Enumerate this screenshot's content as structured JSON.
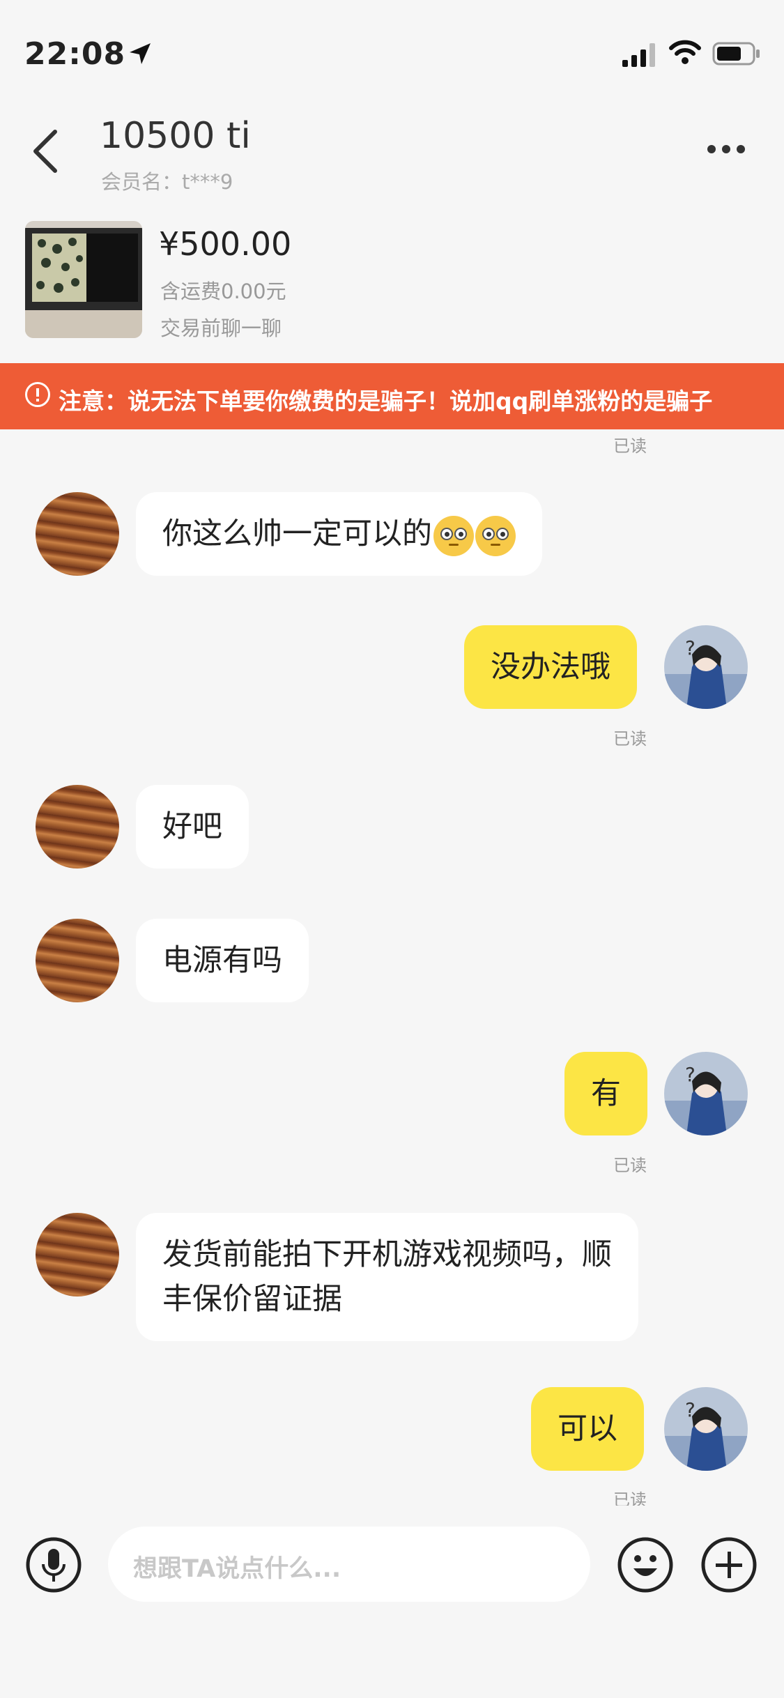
{
  "status_bar": {
    "time": "22:08",
    "location_icon": "location-arrow-icon",
    "signal_icon": "cellular-signal-icon",
    "wifi_icon": "wifi-icon",
    "battery_icon": "battery-icon"
  },
  "header": {
    "title": "10500 ti",
    "member": "会员名：t***9",
    "back_icon": "chevron-left-icon",
    "more_icon": "more-dots-icon"
  },
  "product": {
    "price": "¥500.00",
    "shipping": "含运费0.00元",
    "note": "交易前聊一聊"
  },
  "warning": {
    "text": "注意：说无法下单要你缴费的是骗子！说加qq刷单涨粉的是骗子",
    "color": "#ee5c36"
  },
  "messages": [
    {
      "side": "status",
      "read": "已读"
    },
    {
      "side": "left",
      "text": "你这么帅一定可以的",
      "emoji_count": 2
    },
    {
      "side": "right",
      "text": "没办法哦",
      "read": "已读"
    },
    {
      "side": "left",
      "text": "好吧"
    },
    {
      "side": "left",
      "text": "电源有吗"
    },
    {
      "side": "right",
      "text": "有",
      "read": "已读"
    },
    {
      "side": "left",
      "lines": [
        "发货前能拍下开机游戏视频吗，顺",
        "丰保价留证据"
      ]
    },
    {
      "side": "right",
      "text": "可以",
      "read": "已读"
    }
  ],
  "input_bar": {
    "placeholder": "想跟TA说点什么...",
    "mic_icon": "microphone-icon",
    "emoji_icon": "smiley-icon",
    "plus_icon": "plus-circle-icon"
  },
  "colors": {
    "bubble_self": "#fce545",
    "bubble_other": "#ffffff",
    "background": "#f6f6f6"
  }
}
